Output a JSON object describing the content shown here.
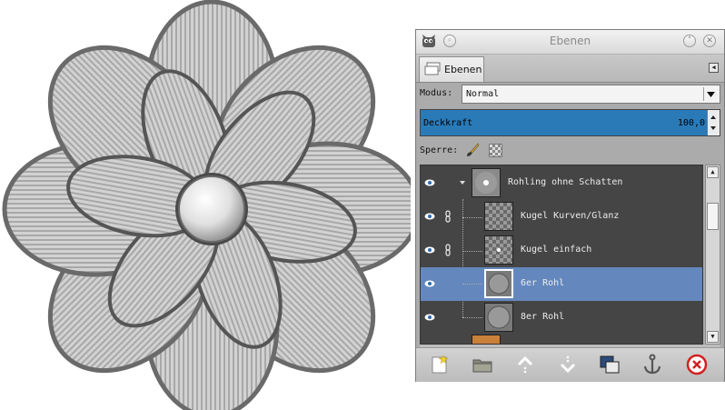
{
  "window": {
    "title": "Ebenen"
  },
  "tab": {
    "label": "Ebenen"
  },
  "mode": {
    "label": "Modus:",
    "value": "Normal"
  },
  "opacity": {
    "label": "Deckkraft",
    "value": "100,0"
  },
  "lock": {
    "label": "Sperre:"
  },
  "layers": [
    {
      "name": "Rohling ohne Schatten",
      "visible": true,
      "chained": false,
      "group": true,
      "selected": false
    },
    {
      "name": "Kugel Kurven/Glanz",
      "visible": true,
      "chained": true,
      "group": false,
      "selected": false
    },
    {
      "name": "Kugel einfach",
      "visible": true,
      "chained": true,
      "group": false,
      "selected": false
    },
    {
      "name": "6er Rohl",
      "visible": true,
      "chained": false,
      "group": false,
      "selected": true
    },
    {
      "name": "8er Rohl",
      "visible": true,
      "chained": false,
      "group": false,
      "selected": false
    }
  ],
  "icons": {
    "app": "gimp-wilber-icon",
    "minimize": "minimize-icon",
    "maximize": "maximize-icon",
    "close": "close-icon",
    "tab": "layers-icon",
    "tab_menu": "tab-menu-icon",
    "lock_pixels": "paintbrush-icon",
    "lock_alpha": "checkerboard-icon",
    "bottom": [
      "new-layer-icon",
      "new-group-icon",
      "raise-layer-icon",
      "lower-layer-icon",
      "duplicate-layer-icon",
      "anchor-icon",
      "delete-icon"
    ]
  },
  "colors": {
    "selection": "#6488bd",
    "opacity_bar": "#2a7ab8",
    "list_background": "#454545",
    "delete": "#d42020"
  }
}
